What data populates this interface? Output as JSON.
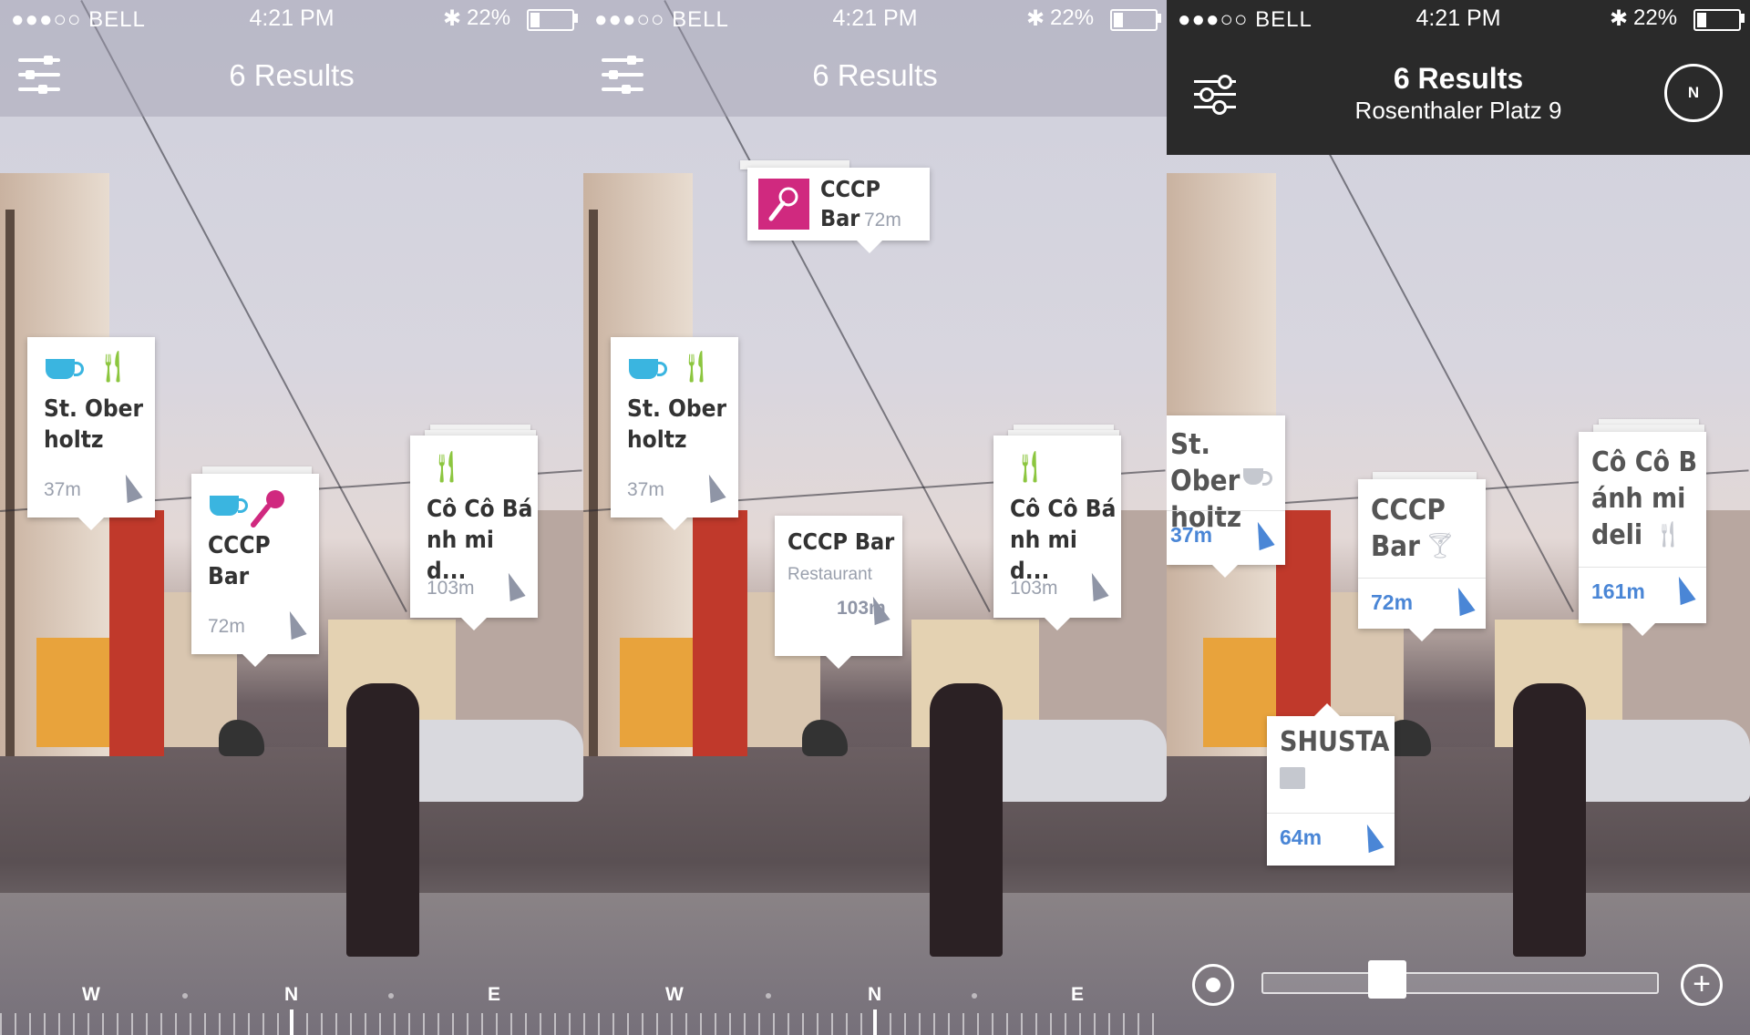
{
  "status": {
    "carrier": "●●●○○ BELL",
    "time": "4:21 PM",
    "battery": "22%"
  },
  "screen1": {
    "title": "6 Results",
    "cards": [
      {
        "name": "St. Ober holtz",
        "dist": "37m"
      },
      {
        "name": "CCCP Bar",
        "dist": "72m"
      },
      {
        "name": "Cô Cô Bá nh mi d...",
        "dist": "103m"
      }
    ],
    "compass": [
      "W",
      "N",
      "E"
    ]
  },
  "screen2": {
    "title": "6 Results",
    "selected": {
      "name": "CCCP Bar",
      "dist": "72m"
    },
    "cards": [
      {
        "name": "St. Ober holtz",
        "dist": "37m"
      },
      {
        "name": "CCCP Bar",
        "sub": "Restaurant",
        "dist": "103m"
      },
      {
        "name": "Cô Cô Bá nh mi d...",
        "dist": "103m"
      }
    ],
    "compass": [
      "W",
      "N",
      "E"
    ]
  },
  "screen3": {
    "title": "6 Results",
    "subtitle": "Rosenthaler Platz 9",
    "compass_label": "N",
    "cards": [
      {
        "name": "St. Ober holtz",
        "dist": "37m"
      },
      {
        "name": "CCCP Bar",
        "dist": "72m"
      },
      {
        "name": "Cô Cô B ánh mi deli",
        "dist": "161m"
      },
      {
        "name": "SHUSTA",
        "dist": "64m"
      }
    ],
    "zoom_level": 0.3
  },
  "colors": {
    "coffee": "#3ab5e0",
    "food": "#8cc63f",
    "bar": "#d0297f",
    "dist_blue": "#4a86d6"
  }
}
